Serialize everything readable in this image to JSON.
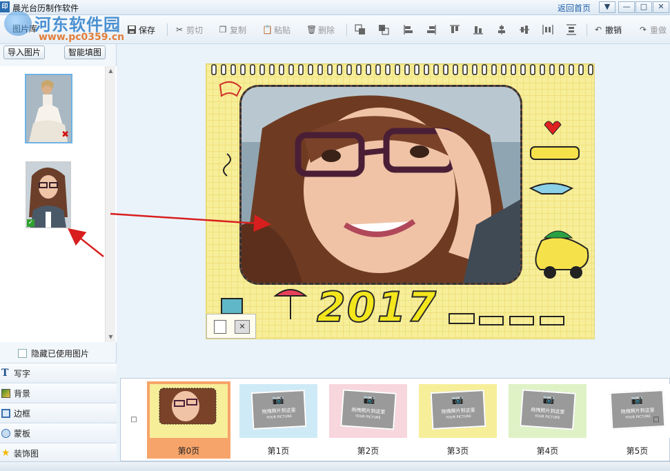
{
  "window": {
    "title": "晨光台历制作软件",
    "return_home": "返回首页",
    "icon_letter": "印",
    "watermark_text": "河东软件园",
    "watermark_url": "www.pc0359.cn"
  },
  "toolbar": {
    "save": "保存",
    "cut": "剪切",
    "copy": "复制",
    "paste": "粘贴",
    "delete": "删除",
    "undo": "撤销",
    "redo": "重做"
  },
  "left_panel": {
    "tab_label": "图片库",
    "import_button": "导入图片",
    "smart_fill_button": "智能填图",
    "hide_used_label": "隐藏已使用图片",
    "menu": [
      {
        "label": "写字",
        "icon": "text-icon"
      },
      {
        "label": "背景",
        "icon": "background-icon"
      },
      {
        "label": "边框",
        "icon": "border-icon"
      },
      {
        "label": "蒙板",
        "icon": "mask-icon"
      },
      {
        "label": "装饰图",
        "icon": "star-icon"
      }
    ]
  },
  "calendar": {
    "year": "2017"
  },
  "filmstrip": {
    "pages": [
      {
        "label": "第0页",
        "theme": "#f7ee9a",
        "active": true
      },
      {
        "label": "第1页",
        "theme": "#cfeaf7",
        "active": false
      },
      {
        "label": "第2页",
        "theme": "#f8d6de",
        "active": false
      },
      {
        "label": "第3页",
        "theme": "#f7ee9a",
        "active": false
      },
      {
        "label": "第4页",
        "theme": "#dff2c6",
        "active": false
      },
      {
        "label": "第5页",
        "theme": "#ffffff",
        "active": false
      }
    ],
    "placeholder_text": "拖拽照片到这里",
    "placeholder_sub": "YOUR PICTURE"
  },
  "colors": {
    "accent": "#1f5fa8",
    "arrow": "#d81e1e",
    "active_page": "#f7a46a"
  }
}
